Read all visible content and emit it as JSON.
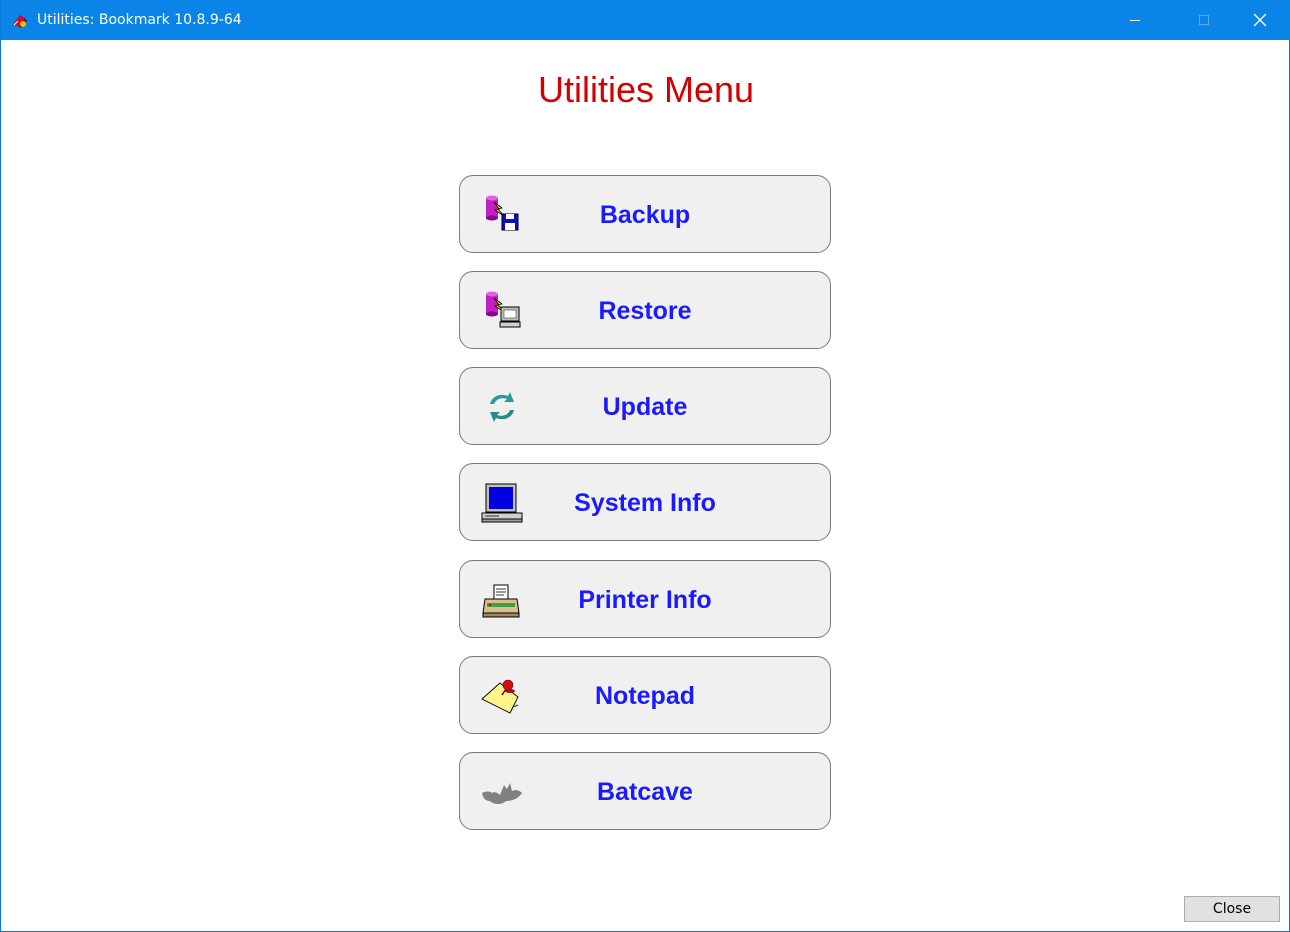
{
  "window": {
    "title": "Utilities: Bookmark 10.8.9-64",
    "app_icon": "bookmark-app-icon",
    "controls": [
      "minimize-icon",
      "maximize-icon",
      "close-icon"
    ]
  },
  "menu": {
    "title": "Utilities Menu",
    "title_color": "#d40000",
    "label_color": "#1a1aff",
    "items": [
      {
        "label": "Backup",
        "icon": "backup-database-floppy-icon"
      },
      {
        "label": "Restore",
        "icon": "restore-database-computer-icon"
      },
      {
        "label": "Update",
        "icon": "update-arrows-icon"
      },
      {
        "label": "System Info",
        "icon": "computer-monitor-icon"
      },
      {
        "label": "Printer Info",
        "icon": "printer-icon"
      },
      {
        "label": "Notepad",
        "icon": "sticky-note-pin-icon"
      },
      {
        "label": "Batcave",
        "icon": "bat-icon"
      }
    ]
  },
  "footer": {
    "close_label": "Close"
  },
  "colors": {
    "titlebar": "#0a84e6",
    "button_bg": "#f0f0f0"
  }
}
